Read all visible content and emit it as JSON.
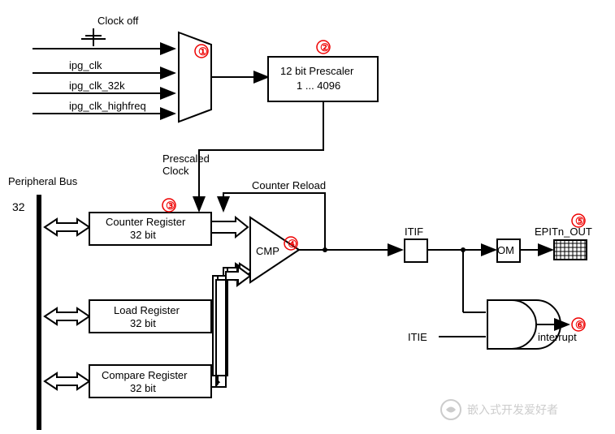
{
  "inputs": {
    "clk_off": "Clock off",
    "ipg_clk": "ipg_clk",
    "ipg_clk_32k": "ipg_clk_32k",
    "ipg_clk_highfreq": "ipg_clk_highfreq"
  },
  "marks": {
    "m1": "①",
    "m2": "②",
    "m3": "③",
    "m4": "④",
    "m5": "⑤",
    "m6": "⑥"
  },
  "prescaler": {
    "title": "12 bit Prescaler",
    "range": "1 ... 4096",
    "out": "Prescaled\nClock"
  },
  "bus": {
    "label": "Peripheral Bus",
    "width": "32"
  },
  "regs": {
    "counter": "Counter Register\n32 bit",
    "load": "Load Register\n32 bit",
    "compare": "Compare Register\n32 bit"
  },
  "cmp": "CMP",
  "signals": {
    "reload": "Counter Reload",
    "itif": "ITIF",
    "itie": "ITIE",
    "om": "OM",
    "out": "EPITn_OUT",
    "interrupt": "interrupt"
  },
  "watermark": "嵌入式开发爱好者"
}
